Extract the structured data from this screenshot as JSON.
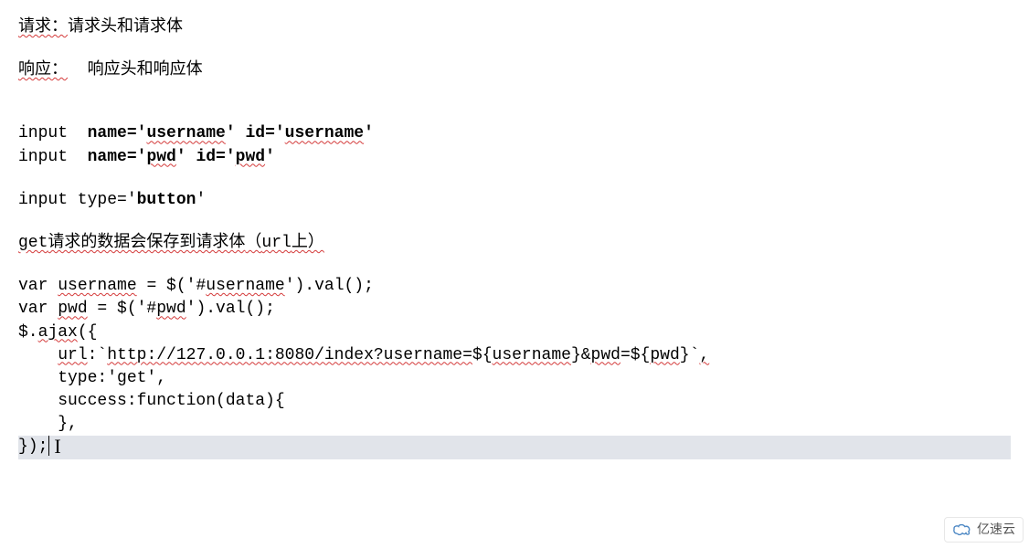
{
  "lines": {
    "l1_a": "请求：",
    "l1_b": "请求头和请求体",
    "l2_a": "响应：",
    "l2_b": "  响",
    "l2_c": "应头和响应体",
    "l4_a": "input  ",
    "l4_b": "name='",
    "l4_c": "username",
    "l4_d": "' id='",
    "l4_e": "username",
    "l4_f": "'",
    "l5_a": "input  ",
    "l5_b": "name='",
    "l5_c": "pwd",
    "l5_d": "' id='",
    "l5_e": "pwd",
    "l5_f": "'",
    "l6_a": "input type='",
    "l6_b": "button",
    "l6_c": "'",
    "l7_a": "get",
    "l7_b": "请求的数据会保存到请求体",
    "l7_c": "（",
    "l7_d": "url",
    "l7_e": "上）",
    "c1_a": "var ",
    "c1_b": "username",
    "c1_c": " = $('#",
    "c1_d": "username",
    "c1_e": "').val();",
    "c2_a": "var ",
    "c2_b": "pwd",
    "c2_c": " = $('#",
    "c2_d": "pwd",
    "c2_e": "').val();",
    "c3_a": "$.",
    "c3_b": "ajax",
    "c3_c": "({",
    "c4_a": "    ",
    "c4_b": "url",
    "c4_c": ":`",
    "c4_d": "http://127.0.0.1:8080/index?username=",
    "c4_e": "${",
    "c4_f": "username",
    "c4_g": "}&",
    "c4_h": "pwd",
    "c4_i": "=${",
    "c4_j": "pwd",
    "c4_k": "}`",
    "c4_l": ",",
    "c5": "    type:'get',",
    "c6": "    success:function(data){",
    "c7": "",
    "c8": "",
    "c9": "    },",
    "c10": "",
    "c11": "});"
  },
  "watermark": "亿速云"
}
